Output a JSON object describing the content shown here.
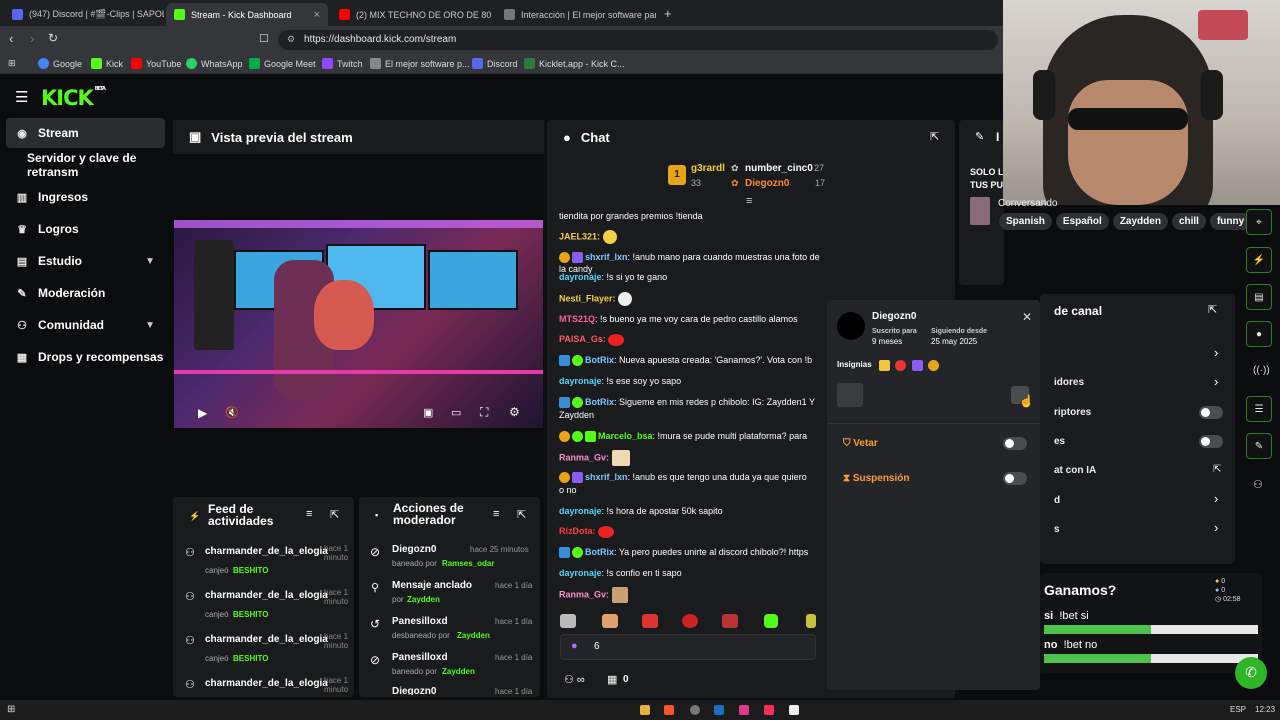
{
  "browser": {
    "tabs": [
      {
        "label": "(947) Discord | #🎬-Clips | SAPOLIOS",
        "active": false
      },
      {
        "label": "Stream - Kick Dashboard",
        "active": true
      },
      {
        "label": "(2) MIX TECHNO DE ORO DE 80's",
        "active": false
      },
      {
        "label": "Interacción | El mejor software para p",
        "active": false
      }
    ],
    "url": "https://dashboard.kick.com/stream",
    "bookmarks": [
      "Google",
      "Kick",
      "YouTube",
      "WhatsApp",
      "Google Meet",
      "Twitch",
      "El mejor software p...",
      "Discord",
      "Kicklet.app - Kick C..."
    ]
  },
  "app": {
    "logo": "KICK",
    "logo_beta": "BETA"
  },
  "sidebar": {
    "items": [
      {
        "label": "Stream",
        "icon": "broadcast-icon"
      },
      {
        "label": "Servidor y clave de retransm",
        "icon": ""
      },
      {
        "label": "Ingresos",
        "icon": "chart-icon"
      },
      {
        "label": "Logros",
        "icon": "trophy-icon"
      },
      {
        "label": "Estudio",
        "icon": "studio-icon"
      },
      {
        "label": "Moderación",
        "icon": "wrench-icon"
      },
      {
        "label": "Comunidad",
        "icon": "community-icon"
      },
      {
        "label": "Drops y recompensas",
        "icon": "drops-icon"
      }
    ]
  },
  "preview": {
    "title": "Vista previa del stream"
  },
  "feed": {
    "title_line1": "Feed de",
    "title_line2": "actividades",
    "rows": [
      {
        "user": "charmander_de_la_elogia",
        "time": "hace 1",
        "time2": "minuto",
        "action": "canjeó",
        "reward": "BESHITO"
      },
      {
        "user": "charmander_de_la_elogia",
        "time": "hace 1",
        "time2": "minuto",
        "action": "canjeó",
        "reward": "BESHITO"
      },
      {
        "user": "charmander_de_la_elogia",
        "time": "hace 1",
        "time2": "minuto",
        "action": "canjeó",
        "reward": "BESHITO"
      },
      {
        "user": "charmander_de_la_elogia",
        "time": "hace 1",
        "time2": "minuto",
        "action": "",
        "reward": ""
      }
    ]
  },
  "modactions": {
    "title_line1": "Acciones de",
    "title_line2": "moderador",
    "rows": [
      {
        "user": "Diegozn0",
        "time": "hace 25 minutos",
        "action": "baneado por",
        "by": "Ramses_odar"
      },
      {
        "user": "Mensaje anclado",
        "time": "hace 1 día",
        "action": "por",
        "by": "Zaydden"
      },
      {
        "user": "Panesilloxd",
        "time": "hace 1 día",
        "action": "desbaneado por",
        "by": "Zaydden"
      },
      {
        "user": "Panesilloxd",
        "time": "hace 1 día",
        "action": "baneado por",
        "by": "Zaydden"
      },
      {
        "user": "Diegozn0",
        "time": "hace 1 día",
        "action": "",
        "by": ""
      }
    ]
  },
  "chat": {
    "title": "Chat",
    "leaderboard": [
      {
        "name": "g3rardl",
        "count": "33"
      },
      {
        "name": "number_cinc0",
        "count": "27"
      },
      {
        "name": "Diegozn0",
        "count": "17"
      }
    ],
    "lines": [
      {
        "user": "",
        "color": "#ffffff",
        "text": "tiendita por grandes premios !tienda"
      },
      {
        "user": "JAEL321",
        "color": "#f5d142",
        "text": ""
      },
      {
        "user": "shxrif_lxn",
        "color": "#7ec8ff",
        "text": "!anub mano para cuando muestras una foto de la candy"
      },
      {
        "user": "dayronaje",
        "color": "#53d6ff",
        "text": "!s si yo te gano"
      },
      {
        "user": "Nesti_Flayer",
        "color": "#f5d142",
        "text": ""
      },
      {
        "user": "MTS21Q",
        "color": "#ff5ea1",
        "text": "!s bueno ya me voy cara de pedro castillo alamos"
      },
      {
        "user": "PAISA_Gs",
        "color": "#ff5e5e",
        "text": ""
      },
      {
        "user": "BotRix",
        "color": "#7ec8ff",
        "text": "Nueva apuesta creada: 'Ganamos?'. Vota con !b"
      },
      {
        "user": "dayronaje",
        "color": "#53d6ff",
        "text": "!s ese soy yo sapo"
      },
      {
        "user": "BotRix",
        "color": "#7ec8ff",
        "text": "Sigueme en mis redes p chibolo: IG: Zaydden1 Y"
      },
      {
        "user": "",
        "color": "#ffffff",
        "text": "Zaydden"
      },
      {
        "user": "Marcelo_bsa",
        "color": "#53fc18",
        "text": "!mura se pude multi plataforma? para"
      },
      {
        "user": "Ranma_Gv",
        "color": "#ff8ed1",
        "text": ""
      },
      {
        "user": "shxrif_lxn",
        "color": "#7ec8ff",
        "text": "!anub es que tengo una duda ya que quiero"
      },
      {
        "user": "",
        "color": "#ffffff",
        "text": "o no"
      },
      {
        "user": "dayronaje",
        "color": "#53d6ff",
        "text": "!s hora de apostar 50k sapito"
      },
      {
        "user": "RizDota",
        "color": "#ff3b3b",
        "text": ""
      },
      {
        "user": "BotRix",
        "color": "#7ec8ff",
        "text": "Ya pero puedes unirte al discord chibolo?! https"
      },
      {
        "user": "dayronaje",
        "color": "#53d6ff",
        "text": "!s confio en ti sapo"
      },
      {
        "user": "Ranma_Gv",
        "color": "#ff8ed1",
        "text": ""
      }
    ],
    "input_count": "6",
    "footer_count": "0"
  },
  "usercard": {
    "name": "Diegozn0",
    "sub_label": "Suscrito para",
    "sub_value": "9 meses",
    "follow_label": "Siguiendo desde",
    "follow_value": "25 may 2025",
    "badges_label": "Insignias",
    "ban_label": "Vetar",
    "timeout_label": "Suspensión"
  },
  "rightpanel": {
    "title_partial": "I",
    "banner_line1": "SOLO L",
    "banner_line2": "TUS PU",
    "category": "Conversando",
    "tags": [
      "Spanish",
      "Español",
      "Zaydden",
      "chill",
      "funny"
    ],
    "channel_title": "de canal",
    "rows": [
      "idores",
      "riptores",
      "es",
      "at con IA",
      "d",
      "s"
    ]
  },
  "poll": {
    "title": "Ganamos?",
    "options": [
      {
        "label": "si",
        "cmd": "!bet si",
        "fraction": 0.5
      },
      {
        "label": "no",
        "cmd": "!bet no",
        "fraction": 0.5
      }
    ],
    "stat1": "0",
    "stat2": "0",
    "timer": "02:58"
  },
  "taskbar": {
    "lang": "ESP",
    "time": "12:23"
  },
  "colors": {
    "accent": "#53fc18",
    "panel": "#191b1c",
    "bg": "#0b0c0d"
  }
}
